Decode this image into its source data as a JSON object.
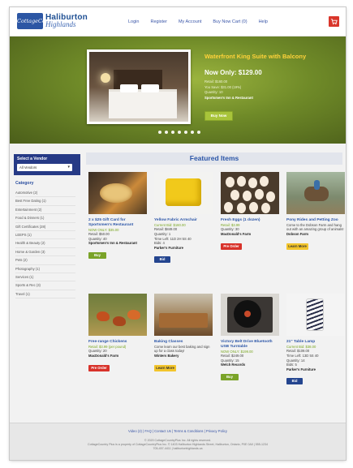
{
  "header": {
    "logo_badge": "CottageCountry",
    "logo_line1": "Haliburton",
    "logo_line2": "Highlands",
    "nav": [
      "Login",
      "Register",
      "My Account",
      "Buy Now Cart (0)",
      "Help"
    ],
    "cart_icon": "cart-icon"
  },
  "hero": {
    "title": "Waterfront King Suite with Balcony",
    "price": "Now Only: $129.00",
    "retail": "Retail: $160.00",
    "you_save": "You Save: $31.00 (19%)",
    "quantity": "Quantity: 10",
    "seller": "Sportsmen's Inn & Restaurant",
    "button": "Buy Now",
    "slide_count": 7,
    "colors": {
      "price_title": "#ffd23a",
      "button": "#a8c43a"
    }
  },
  "sidebar": {
    "vendor_label": "Select a Vendor",
    "vendor_select": "All Vendors",
    "category_title": "Category",
    "categories": [
      "Automotive (2)",
      "Best Free Dating (1)",
      "Entertainment (2)",
      "Food & Dinners (1)",
      "Gift Certificates (28)",
      "LEEPS (1)",
      "Health & Beauty (2)",
      "Home & Garden (3)",
      "Pets (2)",
      "Photography (1)",
      "Services (1)",
      "Sports & Rec (3)",
      "Travel (1)"
    ]
  },
  "featured": {
    "title": "Featured Items",
    "items": [
      {
        "name": "2 x $25 Gift Card for Sportsmen's Restaurant",
        "lines": [
          "NOW ONLY: $35.00",
          "Retail: $50.00",
          "Quantity: 40",
          "Sportsmen's Inn & Restaurant"
        ],
        "button": "Buy",
        "picture": "food-image"
      },
      {
        "name": "Yellow Fabric Armchair",
        "lines": [
          "Current Bid: $160.00",
          "Retail: $849.00",
          "Quantity: 1",
          "Time Left: 11D 2H 5S 40",
          "Bids: 4",
          "Parker's Furniture"
        ],
        "button": "Bid",
        "picture": "armchair-image"
      },
      {
        "name": "Fresh Eggs (1 dozen)",
        "lines": [
          "Retail: $3.99",
          "Quantity: 30",
          "MacDonald's Farm"
        ],
        "button": "Pre Order",
        "picture": "eggs-image"
      },
      {
        "name": "Pony Rides and Petting Zoo",
        "lines": [
          "Come to the Dobson Farm and hang out with an amazing group of animals!",
          "Dobson Farm"
        ],
        "button": "Learn More",
        "picture": "pony-image"
      },
      {
        "name": "Free-range Chickens",
        "lines": [
          "Retail: $3.99 (per pound)",
          "Quantity: 20",
          "MacDonald's Farm"
        ],
        "button": "Pre Order",
        "picture": "chickens-image"
      },
      {
        "name": "Baking Classes",
        "lines": [
          "Come learn our best baking and sign up for a class today!",
          "Winters Bakery"
        ],
        "button": "Learn More",
        "picture": "baking-image"
      },
      {
        "name": "Victory Belt Drive Bluetooth USB Turntable",
        "lines": [
          "NOW ONLY: $199.00",
          "Retail: $249.00",
          "Quantity: 15",
          "Welch Records"
        ],
        "button": "Buy",
        "picture": "turntable-image"
      },
      {
        "name": "21\" Table Lamp",
        "lines": [
          "Current Bid: $38.00",
          "Retail: $109.00",
          "Time Left: 13D 5S 40",
          "Quantity: 14",
          "Bids: 5",
          "Parker's Furniture"
        ],
        "button": "Bid",
        "picture": "lamp-image"
      }
    ]
  },
  "footer": {
    "links": "Video (2) | FAQ | Contact Us | Terms & Conditions | Privacy Policy",
    "copyright": "© 2020 CottageCountryPlus Inc. All rights reserved.",
    "address": "CottageCountry Plus is a property of CottageCountryPlus Inc. © 1403 Haliburton Highlands Street, Haliburton, Ontario, P0E 0A0 | 555-1234",
    "phone": "705-457-4411 | haliburtonhighlands.ca"
  }
}
